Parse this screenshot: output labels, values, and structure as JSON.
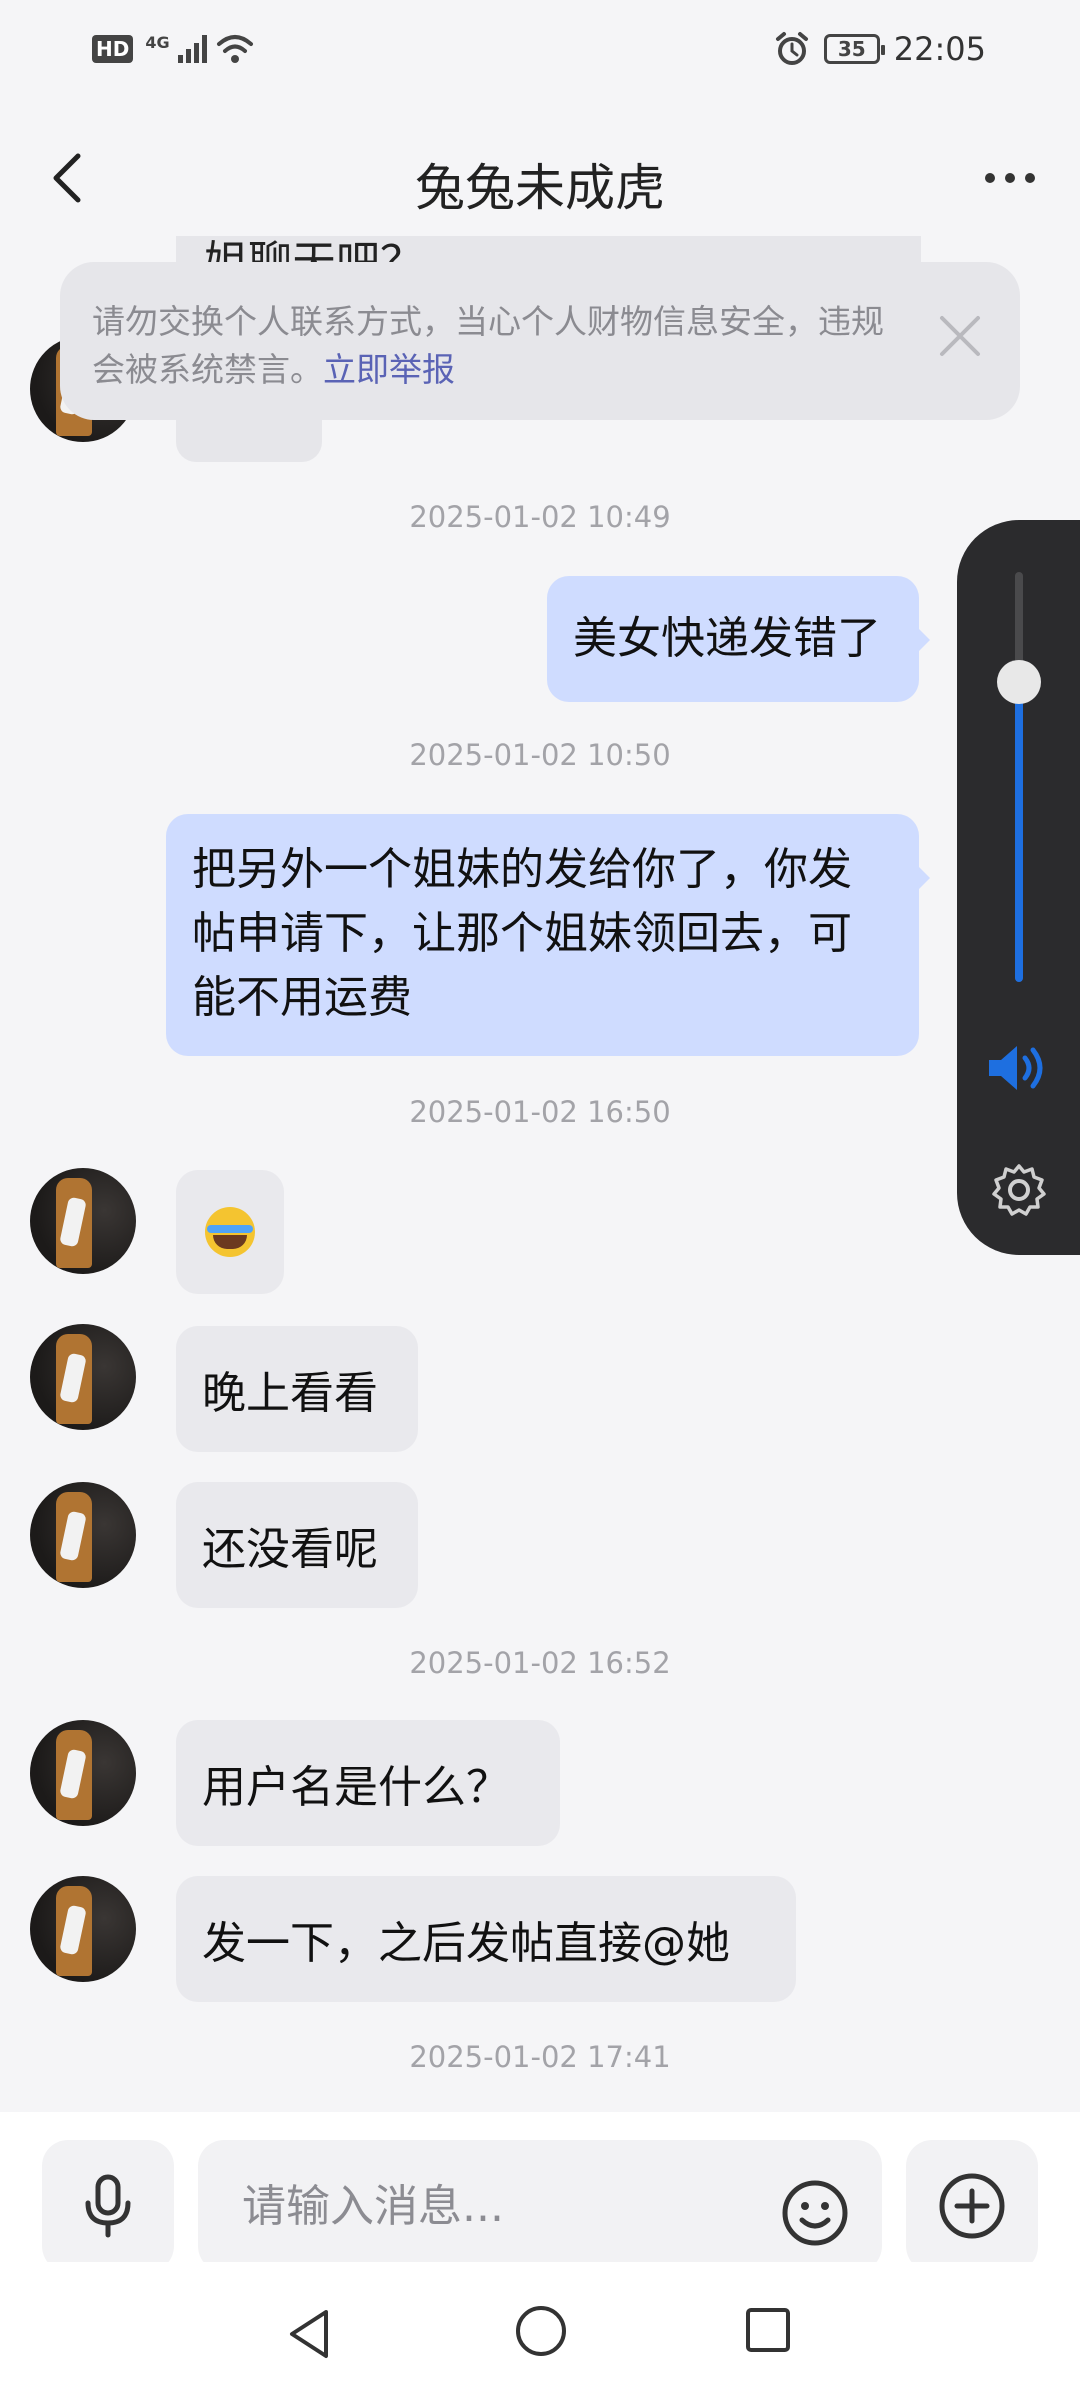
{
  "status_bar": {
    "hd": "HD",
    "network": "4G",
    "battery": "35",
    "time": "22:05"
  },
  "header": {
    "title": "兔兔未成虎"
  },
  "warning": {
    "text": "请勿交换个人联系方式，当心个人财物信息安全，违规会被系统禁言。",
    "link": "立即举报"
  },
  "peek": {
    "top_text": "姐聊天吧？"
  },
  "messages": {
    "ts1": "2025-01-02 10:49",
    "out1": "美女快递发错了",
    "ts2": "2025-01-02 10:50",
    "out2": "把另外一个姐妹的发给你了，你发帖申请下，让那个姐妹领回去，可能不用运费",
    "ts3": "2025-01-02 16:50",
    "in_emoji": "laughing-crying-emoji",
    "in1": "晚上看看",
    "in2": "还没看呢",
    "ts4": "2025-01-02 16:52",
    "in3": "用户名是什么？",
    "in4": "发一下，之后发帖直接@她",
    "ts5": "2025-01-02 17:41"
  },
  "input": {
    "placeholder": "请输入消息..."
  },
  "volume": {
    "level": 0.73,
    "accent": "#1e6fe0"
  },
  "colors": {
    "outgoing_bubble": "#cfdcff",
    "incoming_bubble": "#e9e9ed",
    "link": "#5a63b5"
  }
}
